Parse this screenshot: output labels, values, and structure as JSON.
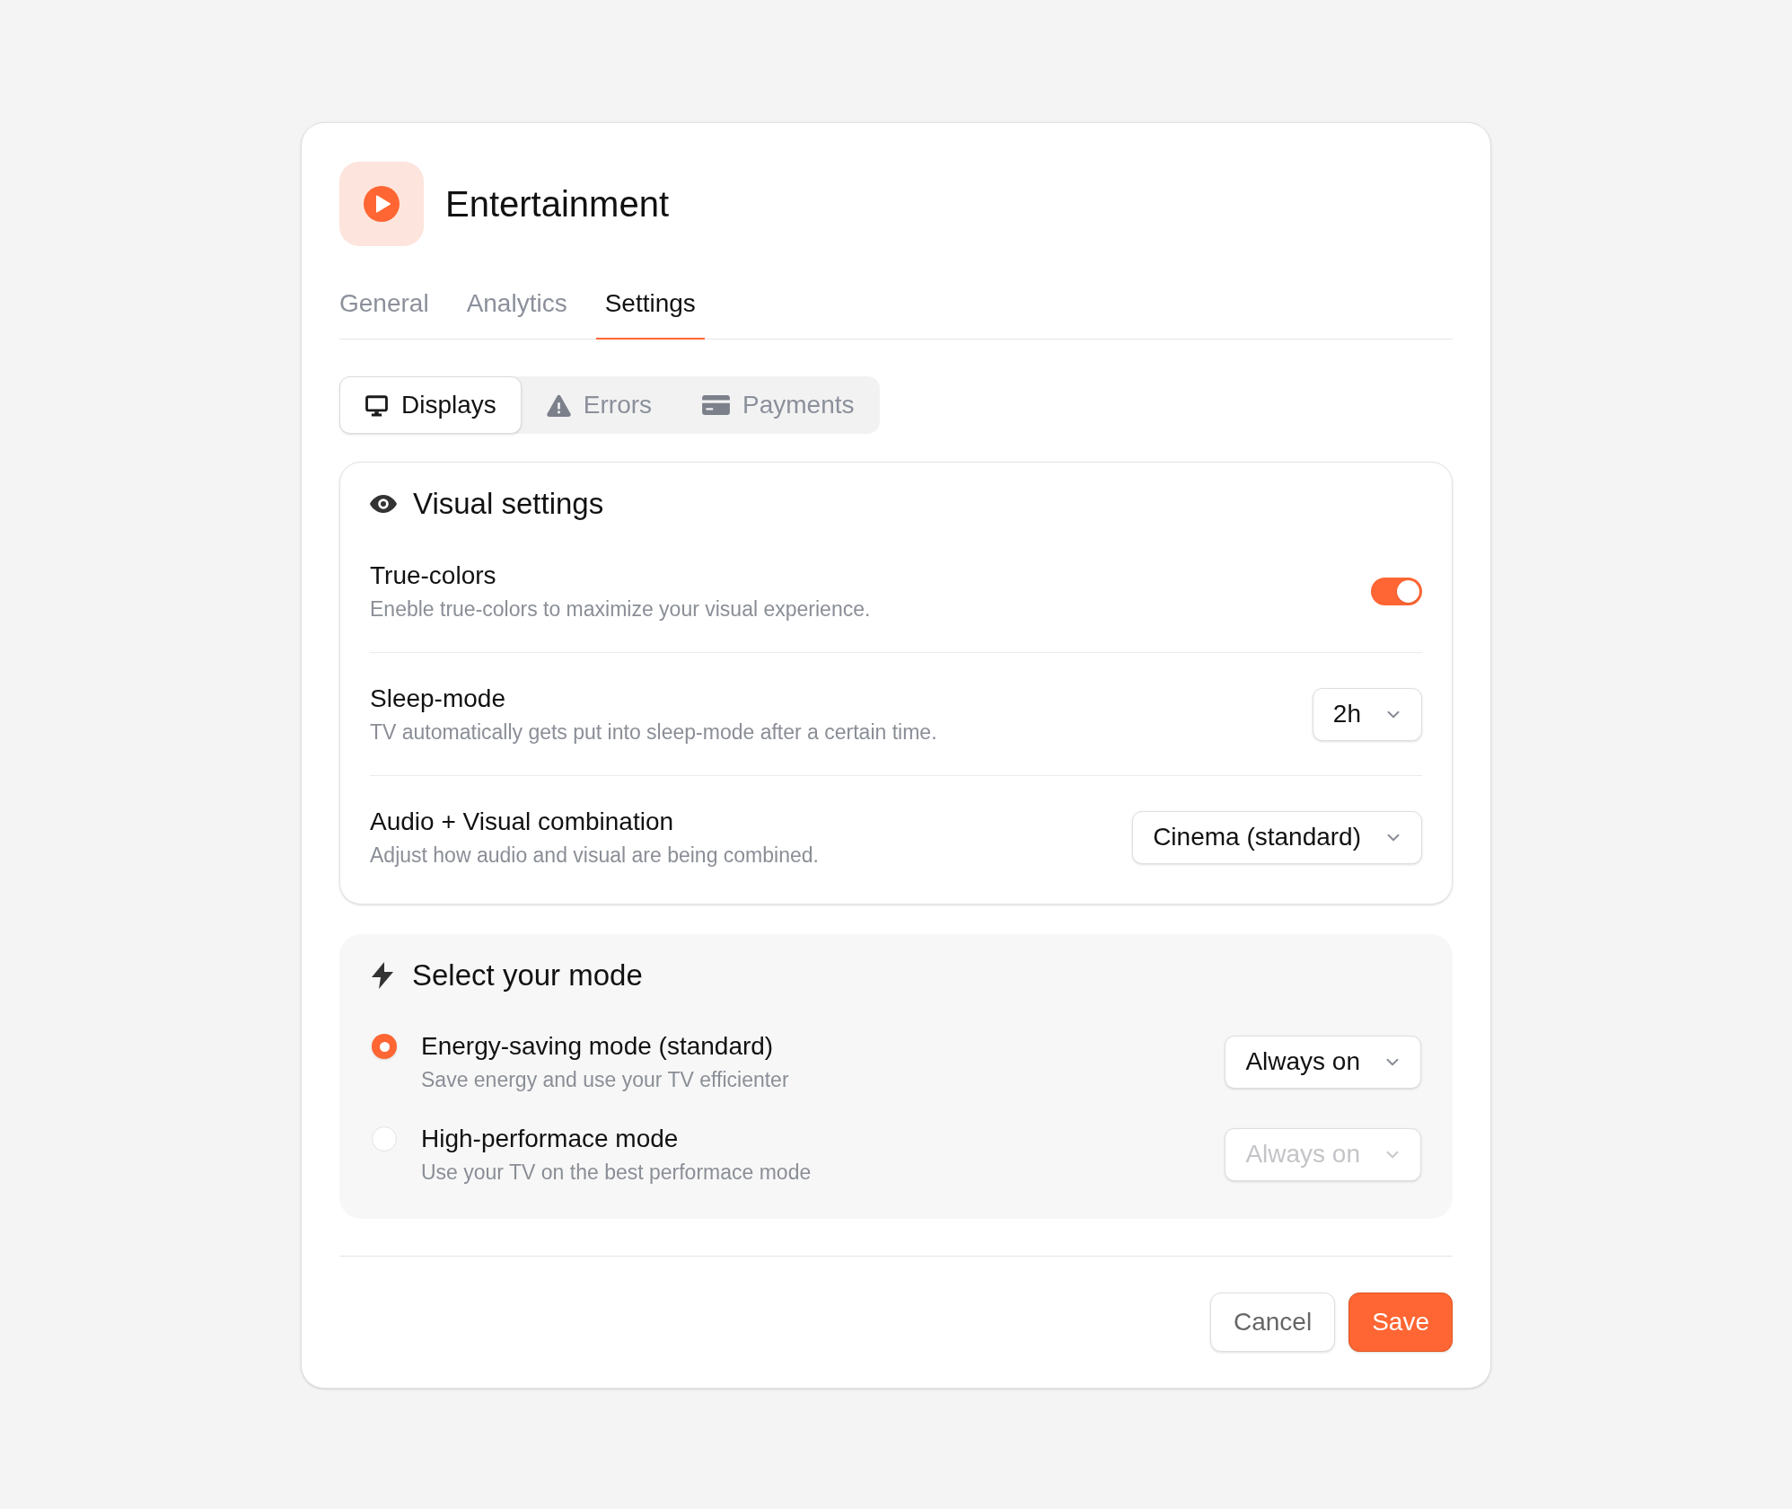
{
  "header": {
    "title": "Entertainment"
  },
  "tabs": [
    {
      "label": "General",
      "selected": false
    },
    {
      "label": "Analytics",
      "selected": false
    },
    {
      "label": "Settings",
      "selected": true
    }
  ],
  "segments": [
    {
      "label": "Displays",
      "selected": true
    },
    {
      "label": "Errors",
      "selected": false
    },
    {
      "label": "Payments",
      "selected": false
    }
  ],
  "visual_settings": {
    "title": "Visual settings",
    "rows": [
      {
        "kind": "toggle",
        "title": "True-colors",
        "description": "Eneble true-colors to maximize your visual experience.",
        "on": true
      },
      {
        "kind": "select",
        "title": "Sleep-mode",
        "description": "TV automatically gets put into sleep-mode after a certain time.",
        "value": "2h"
      },
      {
        "kind": "select",
        "title": "Audio + Visual combination",
        "description": "Adjust how audio and visual are being combined.",
        "value": "Cinema (standard)"
      }
    ]
  },
  "mode": {
    "title": "Select your mode",
    "options": [
      {
        "title": "Energy-saving mode (standard)",
        "description": "Save energy and use your TV efficienter",
        "selected": true,
        "select": {
          "value": "Always on",
          "disabled": false
        }
      },
      {
        "title": "High-performace mode",
        "description": "Use your TV on the best performace mode",
        "selected": false,
        "select": {
          "value": "Always on",
          "disabled": true
        }
      }
    ]
  },
  "buttons": [
    {
      "label": "Cancel",
      "kind": "secondary"
    },
    {
      "label": "Save",
      "kind": "primary"
    }
  ]
}
